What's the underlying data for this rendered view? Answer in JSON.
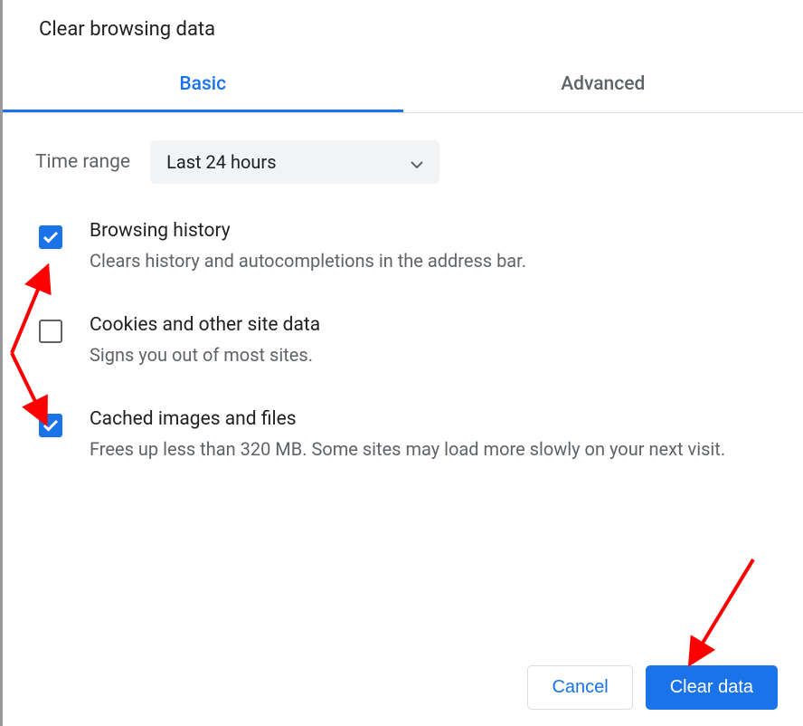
{
  "dialog": {
    "title": "Clear browsing data"
  },
  "tabs": {
    "basic": "Basic",
    "advanced": "Advanced"
  },
  "time_range": {
    "label": "Time range",
    "selected": "Last 24 hours"
  },
  "options": {
    "browsing_history": {
      "title": "Browsing history",
      "desc": "Clears history and autocompletions in the address bar.",
      "checked": true
    },
    "cookies": {
      "title": "Cookies and other site data",
      "desc": "Signs you out of most sites.",
      "checked": false
    },
    "cached": {
      "title": "Cached images and files",
      "desc": "Frees up less than 320 MB. Some sites may load more slowly on your next visit.",
      "checked": true
    }
  },
  "buttons": {
    "cancel": "Cancel",
    "clear": "Clear data"
  }
}
